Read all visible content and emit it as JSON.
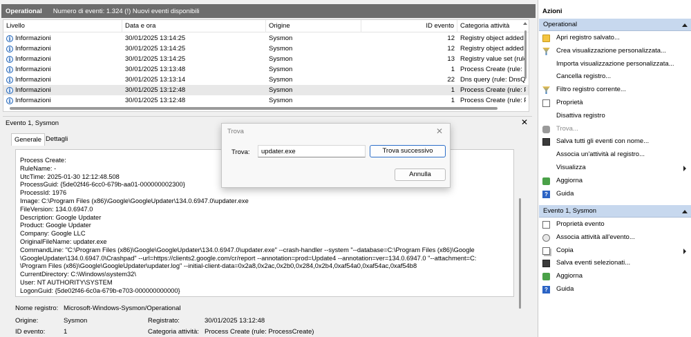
{
  "log": {
    "name": "Operational",
    "summary": "Numero di eventi: 1.324 (!) Nuovi eventi disponibili"
  },
  "grid": {
    "columns": [
      "Livello",
      "Data e ora",
      "Origine",
      "ID evento",
      "Categoria attività"
    ],
    "rows": [
      {
        "level": "Informazioni",
        "datetime": "30/01/2025 13:14:25",
        "source": "Sysmon",
        "id": "12",
        "category": "Registry object added c"
      },
      {
        "level": "Informazioni",
        "datetime": "30/01/2025 13:14:25",
        "source": "Sysmon",
        "id": "12",
        "category": "Registry object added c"
      },
      {
        "level": "Informazioni",
        "datetime": "30/01/2025 13:14:25",
        "source": "Sysmon",
        "id": "13",
        "category": "Registry value set (rule:"
      },
      {
        "level": "Informazioni",
        "datetime": "30/01/2025 13:13:48",
        "source": "Sysmon",
        "id": "1",
        "category": "Process Create (rule: Prc"
      },
      {
        "level": "Informazioni",
        "datetime": "30/01/2025 13:13:14",
        "source": "Sysmon",
        "id": "22",
        "category": "Dns query (rule: DnsQu"
      },
      {
        "level": "Informazioni",
        "datetime": "30/01/2025 13:12:48",
        "source": "Sysmon",
        "id": "1",
        "category": "Process Create (rule: Prc"
      },
      {
        "level": "Informazioni",
        "datetime": "30/01/2025 13:12:48",
        "source": "Sysmon",
        "id": "1",
        "category": "Process Create (rule: Prc"
      }
    ]
  },
  "event": {
    "title": "Evento 1, Sysmon",
    "tabs": [
      "Generale",
      "Dettagli"
    ],
    "details": [
      "Process Create:",
      "RuleName: -",
      "UtcTime: 2025-01-30 12:12:48.508",
      "ProcessGuid: {5de02f46-6cc0-679b-aa01-000000002300}",
      "ProcessId: 1976",
      "Image: C:\\Program Files (x86)\\Google\\GoogleUpdater\\134.0.6947.0\\updater.exe",
      "FileVersion: 134.0.6947.0",
      "Description: Google Updater",
      "Product: Google Updater",
      "Company: Google LLC",
      "OriginalFileName: updater.exe",
      "CommandLine: \"C:\\Program Files (x86)\\Google\\GoogleUpdater\\134.0.6947.0\\updater.exe\" --crash-handler --system \"--database=C:\\Program Files (x86)\\Google",
      "\\GoogleUpdater\\134.0.6947.0\\Crashpad\" --url=https://clients2.google.com/cr/report --annotation=prod=Update4 --annotation=ver=134.0.6947.0 \"--attachment=C:",
      "\\Program Files (x86)\\Google\\GoogleUpdater\\updater.log\" --initial-client-data=0x2a8,0x2ac,0x2b0,0x284,0x2b4,0xaf54a0,0xaf54ac,0xaf54b8",
      "CurrentDirectory: C:\\Windows\\system32\\",
      "User: NT AUTHORITY\\SYSTEM",
      "LogonGuid: {5de02f46-6c0a-679b-e703-000000000000}"
    ],
    "props": {
      "log_name_label": "Nome registro:",
      "log_name_value": "Microsoft-Windows-Sysmon/Operational",
      "source_label": "Origine:",
      "source_value": "Sysmon",
      "logged_label": "Registrato:",
      "logged_value": "30/01/2025 13:12:48",
      "id_label": "ID evento:",
      "id_value": "1",
      "category_label": "Categoria attività:",
      "category_value": "Process Create (rule: ProcessCreate)"
    }
  },
  "find_dialog": {
    "title": "Trova",
    "label": "Trova:",
    "value": "updater.exe",
    "find_next": "Trova successivo",
    "cancel": "Annulla"
  },
  "actions": {
    "title": "Azioni",
    "section1": {
      "header": "Operational",
      "items": [
        {
          "label": "Apri registro salvato...",
          "icon": "folder-icon"
        },
        {
          "label": "Crea visualizzazione personalizzata...",
          "icon": "filter-icon"
        },
        {
          "label": "Importa visualizzazione personalizzata...",
          "icon": "none"
        },
        {
          "label": "Cancella registro...",
          "icon": "none"
        },
        {
          "label": "Filtro registro corrente...",
          "icon": "filter-icon"
        },
        {
          "label": "Proprietà",
          "icon": "properties-icon"
        },
        {
          "label": "Disattiva registro",
          "icon": "none"
        },
        {
          "label": "Trova...",
          "icon": "find-icon"
        },
        {
          "label": "Salva tutti gli eventi con nome...",
          "icon": "save-icon"
        },
        {
          "label": "Associa un'attività al registro...",
          "icon": "none"
        },
        {
          "label": "Visualizza",
          "icon": "none"
        },
        {
          "label": "Aggiorna",
          "icon": "refresh-icon"
        },
        {
          "label": "Guida",
          "icon": "help-icon"
        }
      ]
    },
    "section2": {
      "header": "Evento 1, Sysmon",
      "items": [
        {
          "label": "Proprietà evento",
          "icon": "properties-icon"
        },
        {
          "label": "Associa attività all'evento...",
          "icon": "task-icon"
        },
        {
          "label": "Copia",
          "icon": "copy-icon"
        },
        {
          "label": "Salva eventi selezionati...",
          "icon": "save-icon"
        },
        {
          "label": "Aggiorna",
          "icon": "refresh-icon"
        },
        {
          "label": "Guida",
          "icon": "help-icon"
        }
      ]
    }
  }
}
